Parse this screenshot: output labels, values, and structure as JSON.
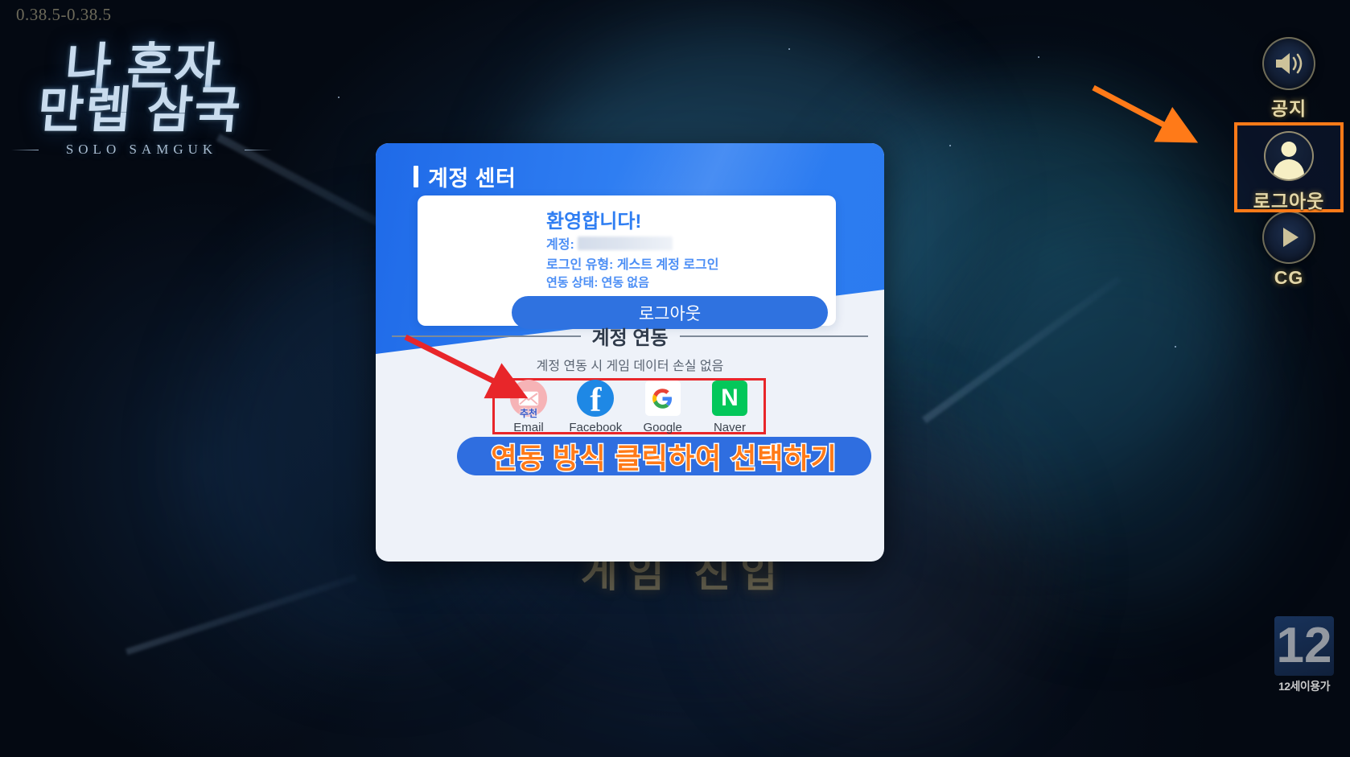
{
  "version": "0.38.5-0.38.5",
  "logo": {
    "line1": "나 혼자",
    "line2": "만렙 삼국",
    "subtitle": "SOLO SAMGUK"
  },
  "background": {
    "game_enter_label": "게임 진입"
  },
  "side_rail": {
    "items": [
      {
        "icon": "speaker-icon",
        "label": "공지"
      },
      {
        "icon": "avatar-icon",
        "label": "로그아웃"
      },
      {
        "icon": "play-icon",
        "label": "CG"
      }
    ]
  },
  "age_rating": {
    "number": "12",
    "caption": "12세이용가"
  },
  "panel": {
    "title": "계정 센터",
    "welcome": {
      "heading": "환영합니다!",
      "account_label": "계정:",
      "account_value": "",
      "login_type": "로그인 유형: 게스트 계정 로그인",
      "link_status": "연동 상태: 연동 없음",
      "logout_button": "로그아웃"
    },
    "linking": {
      "divider_title": "계정 연동",
      "note": "계정 연동 시 게임 데이터 손실 없음",
      "providers": [
        {
          "id": "email",
          "label": "Email",
          "badge": "추천",
          "glyph": "envelope-icon"
        },
        {
          "id": "facebook",
          "label": "Facebook",
          "badge": "",
          "glyph": "facebook-icon"
        },
        {
          "id": "google",
          "label": "Google",
          "badge": "",
          "glyph": "google-icon"
        },
        {
          "id": "naver",
          "label": "Naver",
          "badge": "",
          "glyph": "naver-icon"
        }
      ]
    }
  },
  "annotations": {
    "ribbon_text": "연동 방식 클릭하여 선택하기",
    "highlight_color_orange": "#ff7a18",
    "highlight_color_red": "#e8262a",
    "ribbon_bg": "#2f6ee0"
  },
  "colors": {
    "panel_blue": "#2f7ef2",
    "button_blue": "#2f72e0",
    "panel_bg": "#eef2f9",
    "naver_green": "#03c75a",
    "facebook_blue": "#1e88e5"
  }
}
